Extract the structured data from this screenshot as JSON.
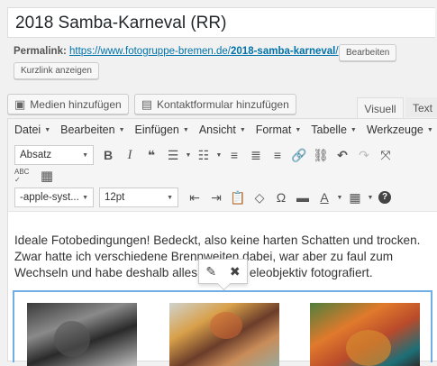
{
  "post": {
    "title": "2018 Samba-Karneval (RR)",
    "permalink_label": "Permalink:",
    "permalink_base": "https://www.fotogruppe-bremen.de/",
    "permalink_slug": "2018-samba-karneval",
    "permalink_trailing": "/",
    "edit_button": "Bearbeiten",
    "shortlink_button": "Kurzlink anzeigen"
  },
  "media_bar": {
    "add_media": "Medien hinzufügen",
    "contact_form": "Kontaktformular hinzufügen"
  },
  "editor_tabs": {
    "visual": "Visuell",
    "text": "Text"
  },
  "menubar": [
    {
      "label": "Datei"
    },
    {
      "label": "Bearbeiten"
    },
    {
      "label": "Einfügen"
    },
    {
      "label": "Ansicht"
    },
    {
      "label": "Format"
    },
    {
      "label": "Tabelle"
    },
    {
      "label": "Werkzeuge"
    }
  ],
  "toolbar": {
    "format_select": "Absatz",
    "font_family": "-apple-syst...",
    "font_size": "12pt",
    "bold": "B",
    "italic": "I",
    "quote": "❝",
    "omega": "Ω",
    "text_color": "A",
    "help": "?",
    "spellcheck": "ABC"
  },
  "content": {
    "paragraph_1": "Ideale Fotobedingungen! Bedeckt, also keine harten Schatten und trocken.",
    "paragraph_2": "Zwar hatte ich verschiedene Brennweiten dabei, war aber zu faul zum",
    "paragraph_3_a": "Wechseln und habe deshalb alles ",
    "paragraph_3_b": "eleobjektiv fotografiert."
  },
  "popup": {
    "edit_icon": "edit-icon",
    "remove_icon": "remove-icon"
  }
}
